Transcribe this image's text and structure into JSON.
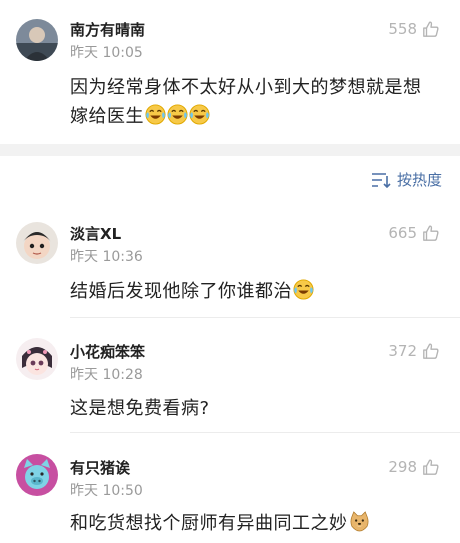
{
  "top_comment": {
    "name": "南方有晴南",
    "time": "昨天 10:05",
    "likes": "558",
    "text": "因为经常身体不太好从小到大的梦想就是想嫁给医生",
    "emojis": [
      "laugh-cry-emoji",
      "laugh-cry-emoji",
      "laugh-cry-emoji"
    ]
  },
  "sort": {
    "label": "按热度",
    "icon": "sort-icon"
  },
  "comments": [
    {
      "name": "淡言XL",
      "time": "昨天 10:36",
      "likes": "665",
      "text": "结婚后发现他除了你谁都治",
      "emojis": [
        "laugh-cry-emoji"
      ]
    },
    {
      "name": "小花痴笨笨",
      "time": "昨天 10:28",
      "likes": "372",
      "text": "这是想免费看病?",
      "emojis": []
    },
    {
      "name": "有只猪诶",
      "time": "昨天 10:50",
      "likes": "298",
      "text": "和吃货想找个厨师有异曲同工之妙",
      "emojis": [
        "doge-emoji"
      ]
    }
  ],
  "colors": {
    "accent": "#4a6fa5",
    "muted": "#9a9a9a",
    "like": "#b4b4b4"
  }
}
